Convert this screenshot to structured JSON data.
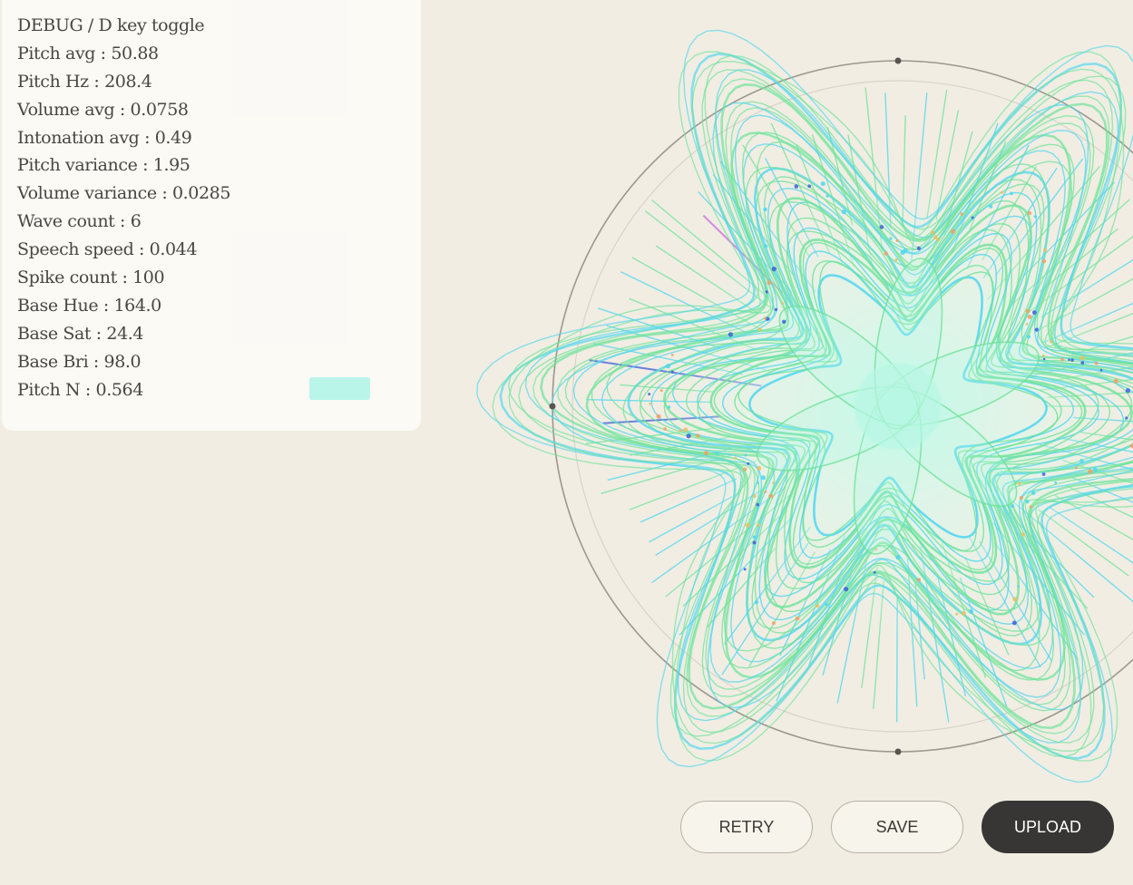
{
  "debug": {
    "title": "DEBUG  /  D key toggle",
    "lines": [
      "Pitch avg : 50.88",
      "Pitch Hz : 208.4",
      "Volume avg : 0.0758",
      "Intonation avg : 0.49",
      "Pitch variance : 1.95",
      "Volume variance : 0.0285",
      "Wave count : 6",
      "Speech speed : 0.044",
      "Spike count : 100",
      "Base Hue : 164.0",
      "Base Sat : 24.4",
      "Base Bri : 98.0",
      "Pitch N : 0.564"
    ],
    "swatch_color": "#b9f6e9"
  },
  "visualization": {
    "wave_count": 6,
    "spike_count": 100,
    "colors": {
      "primary_cyan": "#4fd6ee",
      "primary_green": "#6fe39a",
      "core_mint": "#b8f7e4",
      "accent_blue": "#3f5fd8",
      "accent_magenta": "#c76ae0",
      "accent_orange": "#f0a060",
      "ring": "#8e877e"
    }
  },
  "buttons": {
    "retry": "RETRY",
    "save": "SAVE",
    "upload": "UPLOAD"
  }
}
